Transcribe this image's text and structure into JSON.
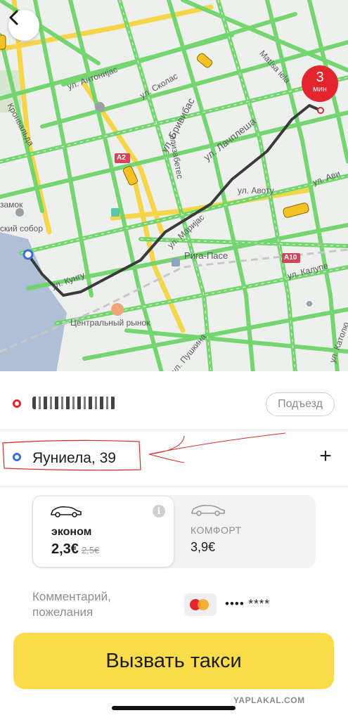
{
  "map": {
    "streets": [
      "ул. Антониjас",
      "ул. Бривибас",
      "ул. Сколас",
      "Matīsa iela",
      "ул. Лачплеша",
      "Элизабетес",
      "ул. Авоту",
      "ул. Мариjас",
      "ул. Кунгу",
      "ул. Пушкина",
      "ул. Калупе",
      "ул. Католю",
      "Кронвальда",
      "ул. Ави"
    ],
    "pois": [
      "Рига-Пасе",
      "Центральный рынок",
      "замок",
      "ский собор"
    ],
    "road_badges": [
      "A2",
      "A10"
    ],
    "eta": {
      "number": "3",
      "unit": "мин"
    }
  },
  "sheet": {
    "from": {
      "address": "[скрыто]",
      "entrance_label": "Подъезд"
    },
    "to": {
      "address": "Яуниела, 39",
      "add_label": "+"
    },
    "tariffs": [
      {
        "name": "эконом",
        "price": "2,3€",
        "old_price": "2,5€",
        "selected": true
      },
      {
        "name": "КОМФОРТ",
        "price": "3,9€",
        "selected": false
      }
    ],
    "comment_label": "Комментарий, пожелания",
    "payment": {
      "card_masked": "•••• ****"
    },
    "call_button": "Вызвать такси"
  },
  "watermark": "YAPLAKAL.COM",
  "colors": {
    "traffic_green": "#6fd46a",
    "traffic_yellow": "#f5d64a",
    "badge_red": "#e3262e",
    "button_yellow": "#fadc4b",
    "route": "#3a3a3a"
  }
}
